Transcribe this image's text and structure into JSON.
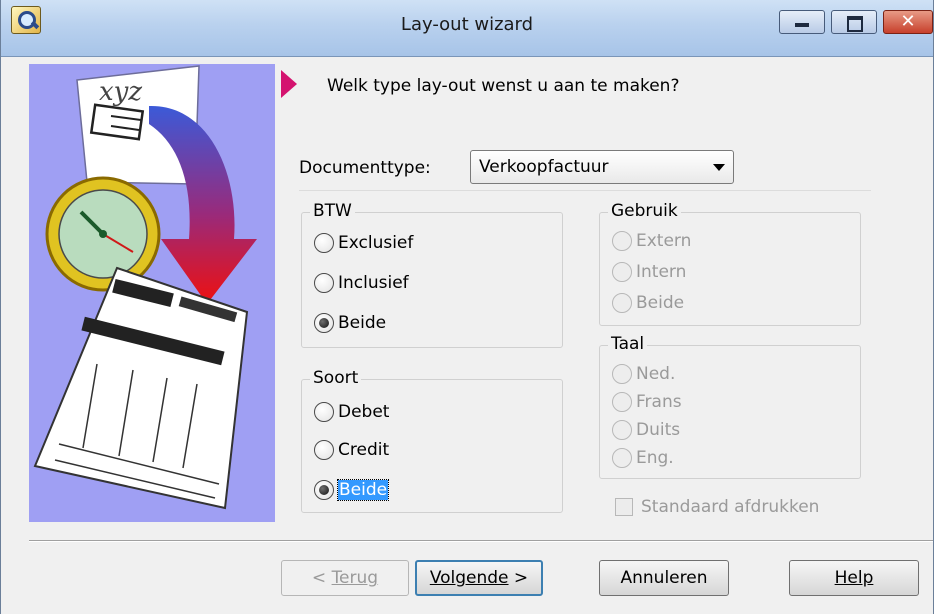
{
  "window": {
    "title": "Lay-out wizard"
  },
  "question": "Welk type lay-out wenst u aan te maken?",
  "doctype": {
    "label": "Documenttype:",
    "value": "Verkoopfactuur"
  },
  "btw": {
    "title": "BTW",
    "options": [
      {
        "label": "Exclusief",
        "checked": false
      },
      {
        "label": "Inclusief",
        "checked": false
      },
      {
        "label": "Beide",
        "checked": true
      }
    ]
  },
  "soort": {
    "title": "Soort",
    "options": [
      {
        "label": "Debet",
        "checked": false
      },
      {
        "label": "Credit",
        "checked": false
      },
      {
        "label": "Beide",
        "checked": true
      }
    ]
  },
  "gebruik": {
    "title": "Gebruik",
    "options": [
      {
        "label": "Extern"
      },
      {
        "label": "Intern"
      },
      {
        "label": "Beide"
      }
    ]
  },
  "taal": {
    "title": "Taal",
    "options": [
      {
        "label": "Ned."
      },
      {
        "label": "Frans"
      },
      {
        "label": "Duits"
      },
      {
        "label": "Eng."
      }
    ]
  },
  "standaard_afdrukken": {
    "label": "Standaard afdrukken",
    "checked": false
  },
  "buttons": {
    "back": {
      "prefix": "< ",
      "label": "Terug"
    },
    "next": {
      "label": "Volgende",
      "suffix": " >"
    },
    "cancel": {
      "label": "Annuleren"
    },
    "help": {
      "label": "Help"
    }
  },
  "illustration": {
    "text": "xyz"
  },
  "colors": {
    "illustration_bg": "#9f9ff3",
    "pointer": "#d4136f",
    "selection": "#3399ff"
  }
}
